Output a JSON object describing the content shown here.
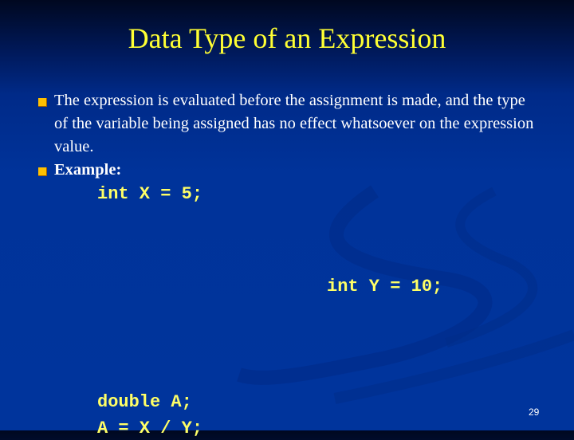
{
  "slide": {
    "title": "Data Type of an Expression",
    "bullets": [
      "The expression is evaluated before the assignment is made, and the type of the variable being assigned has no effect whatsoever on the expression value.",
      "Example:"
    ],
    "code_lines": [
      "int X = 5;",
      "int Y = 10;",
      "double A;",
      "A = X / Y;"
    ],
    "page_number": "29"
  }
}
